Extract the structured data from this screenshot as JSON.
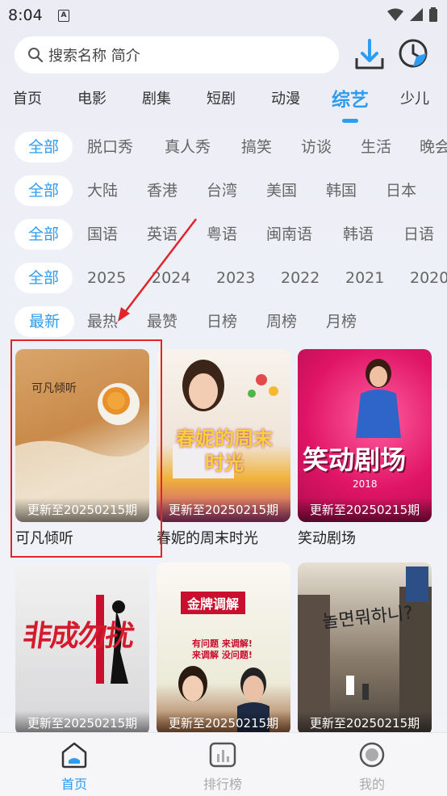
{
  "status": {
    "time": "8:04",
    "sim": "A"
  },
  "search": {
    "placeholder": "搜索名称 简介"
  },
  "tabs": [
    "首页",
    "电影",
    "剧集",
    "短剧",
    "动漫",
    "综艺",
    "少儿"
  ],
  "filters": {
    "types": [
      "全部",
      "脱口秀",
      "真人秀",
      "搞笑",
      "访谈",
      "生活",
      "晚会"
    ],
    "regions": [
      "全部",
      "大陆",
      "香港",
      "台湾",
      "美国",
      "韩国",
      "日本"
    ],
    "languages": [
      "全部",
      "国语",
      "英语",
      "粤语",
      "闽南语",
      "韩语",
      "日语"
    ],
    "years": [
      "全部",
      "2025",
      "2024",
      "2023",
      "2022",
      "2021",
      "2020"
    ],
    "sort": [
      "最新",
      "最热",
      "最赞",
      "日榜",
      "周榜",
      "月榜"
    ]
  },
  "cards": [
    {
      "title": "可凡倾听",
      "update": "更新至20250215期",
      "thumb_text": "可凡倾听"
    },
    {
      "title": "春妮的周末时光",
      "update": "更新至20250215期",
      "thumb_text": "春妮的周末时光"
    },
    {
      "title": "笑动剧场",
      "update": "更新至20250215期",
      "thumb_text": "笑动剧场",
      "thumb_sub": "2018"
    },
    {
      "title": "",
      "update": "更新至20250215期",
      "thumb_text": "非成勿扰"
    },
    {
      "title": "",
      "update": "更新至20250215期",
      "thumb_text": "金牌调解",
      "thumb_sub": "有问题 来调解!",
      "thumb_sub2": "来调解 没问题!"
    },
    {
      "title": "",
      "update": "更新至20250215期",
      "thumb_text": "놀면뭐하니?"
    }
  ],
  "bottom_nav": [
    {
      "label": "首页",
      "icon": "home-icon"
    },
    {
      "label": "排行榜",
      "icon": "chart-icon"
    },
    {
      "label": "我的",
      "icon": "profile-icon"
    }
  ],
  "colors": {
    "accent": "#2e9cf0",
    "annotation": "#e0242a"
  }
}
